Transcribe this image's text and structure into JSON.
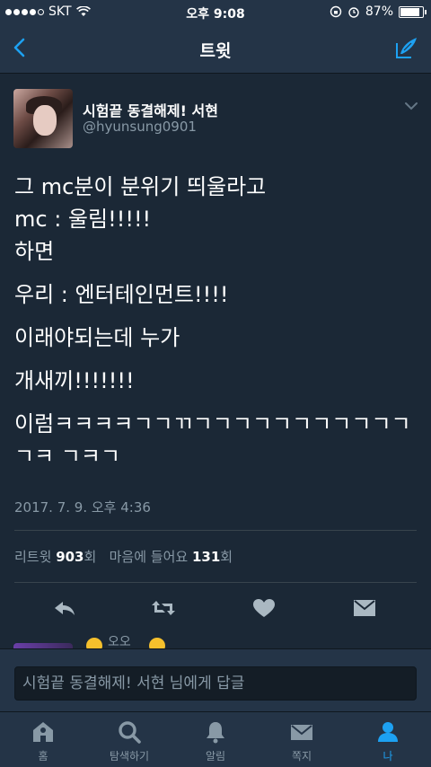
{
  "status_bar": {
    "carrier": "SKT",
    "time": "오후 9:08",
    "battery_percent": "87%",
    "battery_level": 0.87
  },
  "nav": {
    "title": "트윗",
    "back_icon": "chevron-left-icon",
    "compose_icon": "compose-tweet-icon"
  },
  "tweet": {
    "user_name": "시험끝 동결해제! 서현",
    "user_handle": "@hyunsung0901",
    "lines": [
      "그 mc분이 분위기 띄울라고",
      "mc : 울림!!!!!",
      "하면",
      "우리 : 엔터테인먼트!!!!",
      "이래야되는데 누가",
      "개새끼!!!!!!!",
      "이럼ㅋㅋㅋㅋㄱㄱㄲㄱㄱㄱㄱㄱㄱㄱㄱㄱㄱㄱ",
      "ㄱㅋ ㄱㅋㄱ"
    ],
    "timestamp": "2017. 7. 9. 오후 4:36",
    "retweet_label": "리트윗",
    "retweet_count": "903",
    "count_unit": "회",
    "like_label": "마음에 들어요",
    "like_count": "131"
  },
  "actions": [
    "reply-icon",
    "retweet-icon",
    "heart-icon",
    "direct-message-icon"
  ],
  "reply_preview": {
    "text": "오오"
  },
  "reply_bar": {
    "placeholder": "시험끝 동결해제! 서현 님에게 답글"
  },
  "tabs": [
    {
      "label": "홈",
      "icon": "home-icon"
    },
    {
      "label": "탐색하기",
      "icon": "search-icon"
    },
    {
      "label": "알림",
      "icon": "bell-icon"
    },
    {
      "label": "쪽지",
      "icon": "envelope-icon"
    },
    {
      "label": "나",
      "icon": "profile-icon",
      "active": true
    }
  ],
  "colors": {
    "background": "#141d26",
    "surface": "#1b2836",
    "bar": "#243447",
    "accent": "#1da1f2",
    "muted": "#8899a6"
  }
}
